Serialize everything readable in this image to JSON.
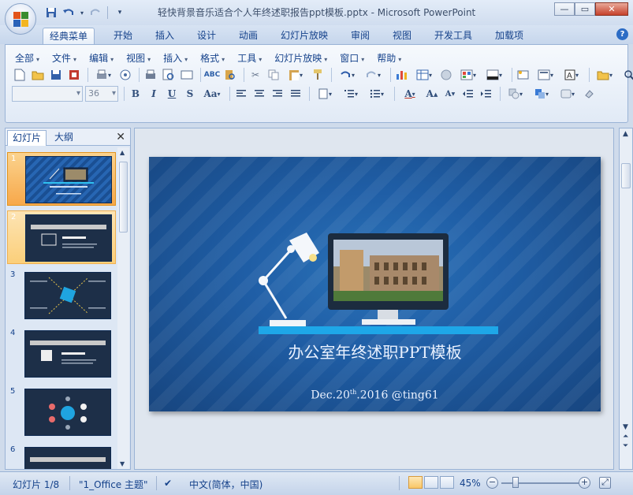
{
  "app": {
    "window_title": "轻快背景音乐适合个人年终述职报告ppt模板.pptx - Microsoft PowerPoint"
  },
  "ribbon_tabs": [
    {
      "label": "经典菜单",
      "active": true
    },
    {
      "label": "开始"
    },
    {
      "label": "插入"
    },
    {
      "label": "设计"
    },
    {
      "label": "动画"
    },
    {
      "label": "幻灯片放映"
    },
    {
      "label": "审阅"
    },
    {
      "label": "视图"
    },
    {
      "label": "开发工具"
    },
    {
      "label": "加载项"
    }
  ],
  "menus": [
    {
      "label": "全部"
    },
    {
      "label": "文件"
    },
    {
      "label": "编辑"
    },
    {
      "label": "视图"
    },
    {
      "label": "插入"
    },
    {
      "label": "格式"
    },
    {
      "label": "工具"
    },
    {
      "label": "幻灯片放映"
    },
    {
      "label": "窗口"
    },
    {
      "label": "帮助"
    }
  ],
  "format_bar": {
    "font_name": "",
    "font_size": "36"
  },
  "left_panel": {
    "tabs": [
      {
        "label": "幻灯片",
        "active": true
      },
      {
        "label": "大纲"
      }
    ],
    "thumbnails": [
      {
        "number": "1",
        "state": "selected"
      },
      {
        "number": "2",
        "state": "hover"
      },
      {
        "number": "3"
      },
      {
        "number": "4"
      },
      {
        "number": "5"
      },
      {
        "number": "6"
      }
    ]
  },
  "slide": {
    "title": "办公室年终述职PPT模板",
    "subtitle_prefix": "Dec.20",
    "subtitle_sup": "th",
    "subtitle_suffix": ".2016 @ting61"
  },
  "status": {
    "slide_counter": "幻灯片 1/8",
    "theme": "\"1_Office 主题\"",
    "language": "中文(简体，中国)",
    "zoom": "45%"
  },
  "colors": {
    "ribbon_bg": "#dfe8f4",
    "slide_blue": "#1f5ea6",
    "accent_cyan": "#00a8e6",
    "selected_thumb": "#f7a84a"
  }
}
